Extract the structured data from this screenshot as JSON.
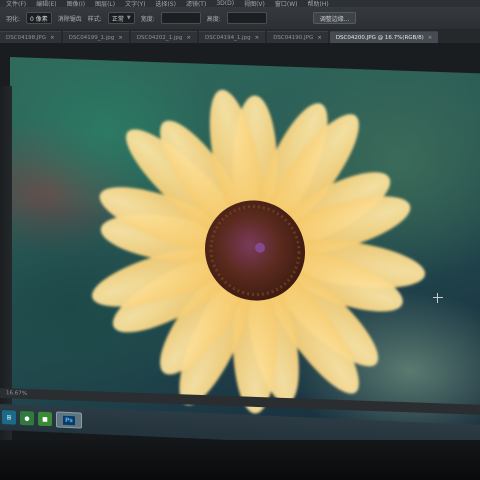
{
  "menubar": {
    "items": [
      "文件(F)",
      "编辑(E)",
      "图像(I)",
      "图层(L)",
      "文字(Y)",
      "选择(S)",
      "滤镜(T)",
      "3D(D)",
      "视图(V)",
      "窗口(W)",
      "帮助(H)"
    ]
  },
  "options": {
    "mode_label": "羽化:",
    "mode_value": "0 像素",
    "antialias_label": "消除锯齿",
    "style_label": "样式:",
    "style_value": "正常",
    "width_label": "宽度:",
    "height_label": "高度:",
    "refine_button": "调整边缘..."
  },
  "tabs": [
    {
      "label": "DSC04198.JPG",
      "active": false
    },
    {
      "label": "DSC04199_1.jpg",
      "active": false
    },
    {
      "label": "DSC04202_1.jpg",
      "active": false
    },
    {
      "label": "DSC04194_1.jpg",
      "active": false
    },
    {
      "label": "DSC04190.JPG",
      "active": false
    },
    {
      "label": "DSC04200.JPG @ 16.7%(RGB/8)",
      "active": true
    }
  ],
  "status": {
    "zoom": "16.67%"
  },
  "taskbar": {
    "ps_label": "Ps"
  },
  "colors": {
    "petal": "#f6cf72",
    "petal_light": "#fbe3a0",
    "center": "#5b2a1e",
    "background_green": "#2f6b5c"
  },
  "icons": [
    "windows-start-icon",
    "app-icon",
    "app-icon",
    "photoshop-icon",
    "crosshair-icon"
  ]
}
